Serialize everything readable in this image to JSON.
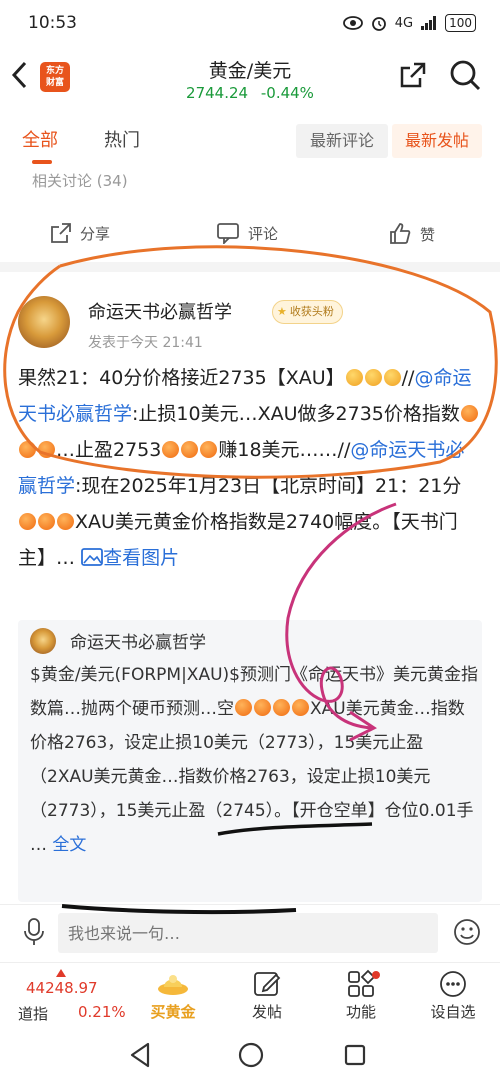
{
  "status_bar": {
    "time": "10:53",
    "network": "4G",
    "battery": "100"
  },
  "nav": {
    "title": "黄金/美元",
    "price": "2744.24",
    "change": "-0.44%",
    "logo_line1": "东方",
    "logo_line2": "财富"
  },
  "tabs": {
    "all": "全部",
    "hot": "热门",
    "latest_comment": "最新评论",
    "latest_post": "最新发帖"
  },
  "related": "相关讨论 (34)",
  "actions": {
    "share": "分享",
    "comment": "评论",
    "like": "赞"
  },
  "post": {
    "author": "命运天书必赢哲学",
    "badge": "收获头粉",
    "time": "发表于今天 21:41",
    "p1": "果然21：40分价格接近2735【XAU】",
    "p2_sep": "//",
    "p2_mention": "@命运天书必赢哲学",
    "p2_text": ":止损10美元…XAU做多2735价格指数",
    "p2_tail": "…止盈2753",
    "p3": "赚18美元……//",
    "p3_mention": "@命运天书必赢哲学",
    "p3_text": ":现在2025年1月23日【北京时间】21：21分",
    "p4": "XAU美元黄金价格指数是2740幅度。【天书门主】…",
    "view_images": "查看图片"
  },
  "quote": {
    "author": "命运天书必赢哲学",
    "text1": "$黄金/美元(FORPM|XAU)$预测门《命运天书》美元黄金指数篇…抛两个硬币预测…空",
    "text2": "XAU美元黄金…指数价格2763，设定止损10美元（2773），15美元止盈（2XAU美元黄金…指数价格2763，设定止损10美元（2773），15美元止盈（2745）。【开仓空单】仓位0.01手 …",
    "full_text": "全文"
  },
  "comment_bar": {
    "placeholder": "我也来说一句…"
  },
  "bottom": {
    "index_value": "44248.97",
    "index_name": "道指",
    "index_pct": "0.21%",
    "buy_gold": "买黄金",
    "post": "发帖",
    "function": "功能",
    "customize": "设自选"
  },
  "colors": {
    "accent": "#e8541c",
    "link": "#2a6fd8",
    "up_red": "#e03a2a",
    "price_green": "#1a9a3a",
    "annotation": "#e8732a"
  }
}
